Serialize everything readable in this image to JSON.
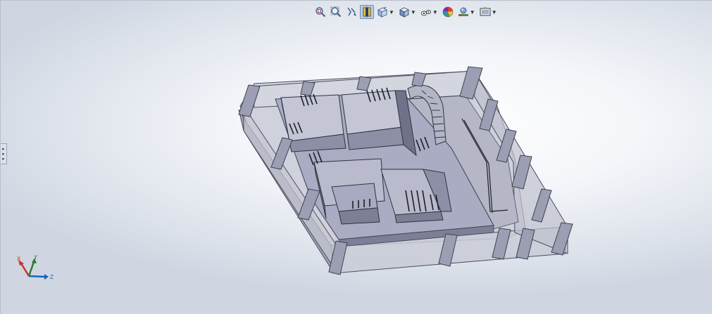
{
  "app": {
    "window": "SolidWorks-style 3D model viewport"
  },
  "toolbar": {
    "buttons": [
      {
        "id": "zoom-to-fit",
        "icon": "zoom-to-fit-icon",
        "active": false,
        "dropdown": false
      },
      {
        "id": "zoom-to-area",
        "icon": "zoom-area-icon",
        "active": false,
        "dropdown": false
      },
      {
        "id": "previous-view",
        "icon": "previous-view-icon",
        "active": false,
        "dropdown": false
      },
      {
        "id": "section-view",
        "icon": "section-view-icon",
        "active": true,
        "dropdown": false
      },
      {
        "id": "view-orientation",
        "icon": "view-orientation-icon",
        "active": false,
        "dropdown": true
      },
      {
        "id": "display-style",
        "icon": "display-style-cube-icon",
        "active": false,
        "dropdown": true
      },
      {
        "id": "hide-show-items",
        "icon": "hide-show-eye-icon",
        "active": false,
        "dropdown": true
      },
      {
        "id": "edit-appearance",
        "icon": "appearance-sphere-icon",
        "active": false,
        "dropdown": false
      },
      {
        "id": "apply-scene",
        "icon": "scene-icon",
        "active": false,
        "dropdown": true
      },
      {
        "id": "view-settings",
        "icon": "view-settings-icon",
        "active": false,
        "dropdown": true
      }
    ]
  },
  "triad": {
    "x_label": "X",
    "y_label": "Y",
    "z_label": "Z"
  },
  "colors": {
    "model_floor": "#a9acc2",
    "model_top": "#c4c6d6",
    "model_side": "#7c7f95",
    "glass": "#cfd2dc",
    "active_button": "#b7cbe6"
  }
}
